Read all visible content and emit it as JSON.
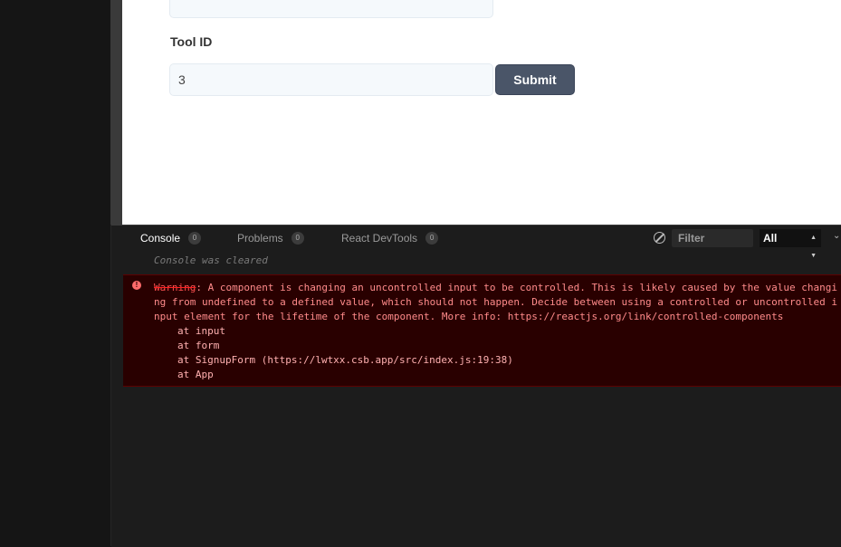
{
  "preview": {
    "tool_label": "Tool ID",
    "tool_value": "3",
    "submit_label": "Submit"
  },
  "devtools": {
    "tabs": [
      {
        "label": "Console",
        "count": "0"
      },
      {
        "label": "Problems",
        "count": "0"
      },
      {
        "label": "React DevTools",
        "count": "0"
      }
    ],
    "filter_placeholder": "Filter",
    "level": "All",
    "cleared_text": "Console was cleared",
    "error": {
      "prefix": "Warning",
      "message": ": A component is changing an uncontrolled input to be controlled. This is likely caused by the value changing from undefined to a defined value, which should not happen. Decide between using a controlled or uncontrolled input element for the lifetime of the component. More info: https://reactjs.org/link/controlled-components",
      "stack": [
        "at input",
        "at form",
        "at SignupForm (https://lwtxx.csb.app/src/index.js:19:38)",
        "at App"
      ]
    }
  },
  "colors": {
    "submit_bg": "#4a5568",
    "error_bg": "#290000",
    "error_text": "#ff8b8b"
  }
}
